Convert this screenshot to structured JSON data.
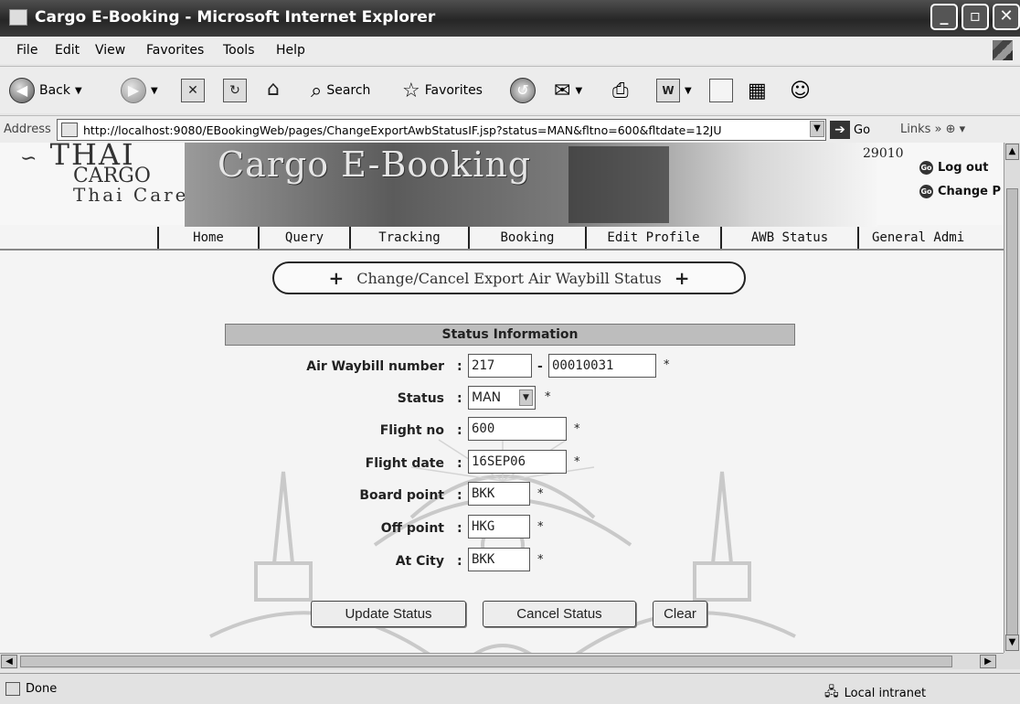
{
  "window": {
    "title": "Cargo E-Booking - Microsoft Internet Explorer",
    "controls": [
      "minimize",
      "maximize",
      "close"
    ]
  },
  "menu": [
    "File",
    "Edit",
    "View",
    "Favorites",
    "Tools",
    "Help"
  ],
  "toolbar": {
    "back": "Back",
    "search": "Search",
    "favorites": "Favorites"
  },
  "address": {
    "label": "Address",
    "url": "http://localhost:9080/EBookingWeb/pages/ChangeExportAwbStatusIF.jsp?status=MAN&fltno=600&fltdate=12JU",
    "go": "Go",
    "links": "Links"
  },
  "banner": {
    "logo_line1": "THAI",
    "logo_line2": "CARGO",
    "logo_line3": "Thai Care",
    "title": "Cargo E-Booking",
    "user_id": "29010",
    "logout": "Log out",
    "change": "Change P"
  },
  "nav": {
    "tabs": [
      "Home",
      "Query",
      "Tracking",
      "Booking",
      "Edit Profile",
      "AWB Status",
      "General Admi"
    ]
  },
  "page": {
    "title": "Change/Cancel Export Air Waybill Status"
  },
  "form": {
    "header": "Status Information",
    "awb_label": "Air Waybill number",
    "awb_prefix": "217",
    "awb_dash": "-",
    "awb_serial": "00010031",
    "status_label": "Status",
    "status_value": "MAN",
    "flight_no_label": "Flight no",
    "flight_no_value": "600",
    "flight_date_label": "Flight date",
    "flight_date_value": "16SEP06",
    "board_point_label": "Board point",
    "board_point_value": "BKK",
    "off_point_label": "Off point",
    "off_point_value": "HKG",
    "at_city_label": "At City",
    "at_city_value": "BKK",
    "colon": ":",
    "required_mark": "*"
  },
  "buttons": {
    "update": "Update Status",
    "cancel": "Cancel Status",
    "clear": "Clear"
  },
  "status_bar": {
    "left": "Done",
    "zone": "Local intranet"
  }
}
